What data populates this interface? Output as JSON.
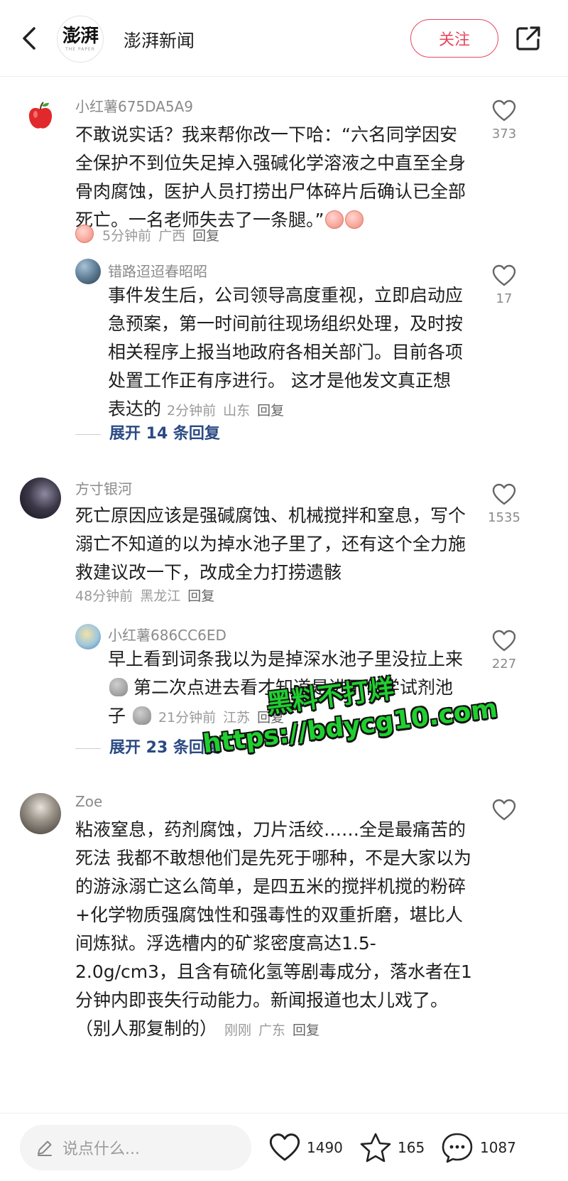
{
  "header": {
    "logo_text": "澎湃",
    "logo_sub": "THE PAPER",
    "brand_name": "澎湃新闻",
    "follow_label": "关注"
  },
  "comments": [
    {
      "user": "小红薯675DA5A9",
      "text": "不敢说实话？我来帮你改一下哈：“六名同学因安全保护不到位失足掉入强碱化学溶液之中直至全身骨肉腐蚀，医护人员打捞出尸体碎片后确认已全部死亡。一名老师失去了一条腿。”",
      "time": "5分钟前",
      "location": "广西",
      "reply_label": "回复",
      "likes": "373",
      "reply": {
        "user": "错路迢迢春昭昭",
        "text": "事件发生后，公司领导高度重视，立即启动应急预案，第一时间前往现场组织处理，及时按相关程序上报当地政府各相关部门。目前各项处置工作正有序进行。 这才是他发文真正想表达的",
        "time": "2分钟前",
        "location": "山东",
        "reply_label": "回复",
        "likes": "17"
      },
      "expand_label": "展开 14 条回复"
    },
    {
      "user": "方寸银河",
      "text": "死亡原因应该是强碱腐蚀、机械搅拌和窒息，写个溺亡不知道的以为掉水池子里了，还有这个全力施救建议改一下，改成全力打捞遗骸",
      "time": "48分钟前",
      "location": "黑龙江",
      "reply_label": "回复",
      "likes": "1535",
      "reply": {
        "user": "小红薯686CC6ED",
        "text_a": "早上看到词条我以为是掉深水池子里没拉上来",
        "text_b": "第二次点进去看才知道是进了化学试剂池子",
        "time": "21分钟前",
        "location": "江苏",
        "reply_label": "回复",
        "likes": "227"
      },
      "expand_label": "展开 23 条回复"
    },
    {
      "user": "Zoe",
      "text": "粘液窒息，药剂腐蚀，刀片活绞……全是最痛苦的死法 我都不敢想他们是先死于哪种，不是大家以为的游泳溺亡这么简单，是四五米的搅拌机搅的粉碎+化学物质强腐蚀性和强毒性的双重折磨，堪比人间炼狱。浮选槽内的矿浆密度高达1.5-2.0g/cm3，且含有硫化氢等剧毒成分，落水者在1分钟内即丧失行动能力。新闻报道也太儿戏了。（别人那复制的）",
      "time": "刚刚",
      "location": "广东",
      "reply_label": "回复"
    }
  ],
  "watermark": {
    "line1": "黑料不打烊",
    "line2": "https://bdycg10.com"
  },
  "bottom": {
    "input_placeholder": "说点什么...",
    "like_count": "1490",
    "star_count": "165",
    "comment_count": "1087"
  },
  "colors": {
    "accent": "#e8475e",
    "link": "#2b4a84",
    "watermark": "#1fcf2f"
  },
  "icons": [
    "back-icon",
    "share-icon",
    "heart-icon",
    "star-icon",
    "comment-icon",
    "pencil-icon",
    "apple-icon",
    "peach-emoji-icon",
    "poop-emoji-icon"
  ]
}
